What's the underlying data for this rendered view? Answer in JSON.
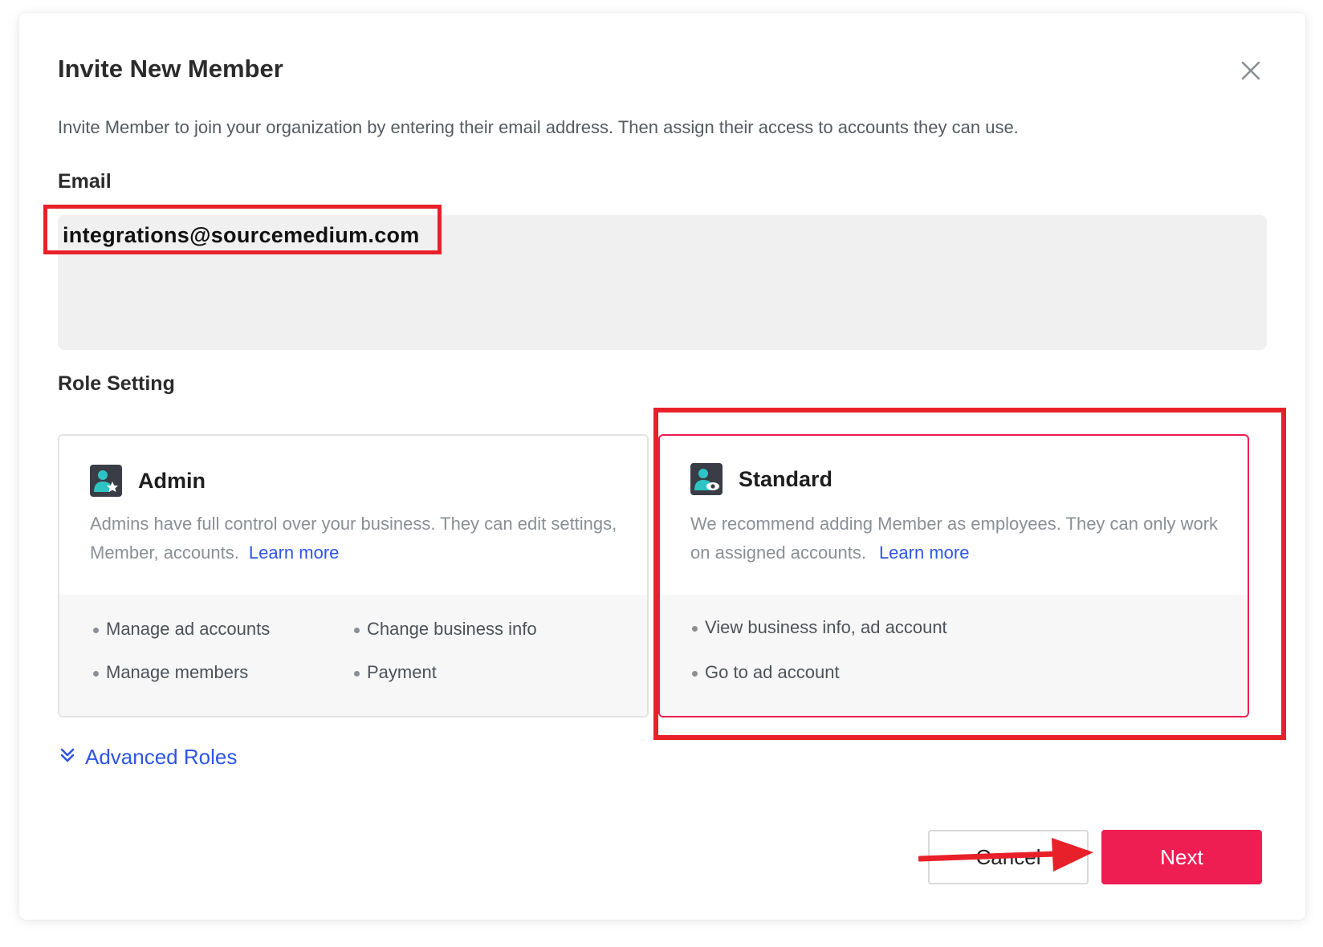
{
  "modal": {
    "title": "Invite New Member",
    "subtitle": "Invite Member to join your organization by entering their email address. Then assign their access to accounts they can use."
  },
  "email": {
    "label": "Email",
    "value": "integrations@sourcemedium.com"
  },
  "roles": {
    "label": "Role Setting",
    "admin": {
      "name": "Admin",
      "description": "Admins have full control over your business. They can edit settings, Member, accounts.",
      "link": "Learn more",
      "permissions": [
        "Manage ad accounts",
        "Change business info",
        "Manage members",
        "Payment"
      ]
    },
    "standard": {
      "name": "Standard",
      "description": "We recommend adding Member as employees. They can only work on assigned accounts.",
      "link": "Learn more",
      "permissions": [
        "View business info, ad account",
        "Go to ad account"
      ],
      "selected": true
    }
  },
  "advanced": {
    "label": "Advanced Roles"
  },
  "footer": {
    "cancel_label": "Cancel",
    "next_label": "Next"
  },
  "colors": {
    "accent": "#ee1d52",
    "link": "#2e55e6",
    "highlight": "#e8202a",
    "icon_teal": "#2ec4c4"
  },
  "icons": {
    "close": "close-icon",
    "admin": "admin-user-star-icon",
    "standard": "standard-user-eye-icon",
    "advanced": "double-chevron-down-icon"
  }
}
